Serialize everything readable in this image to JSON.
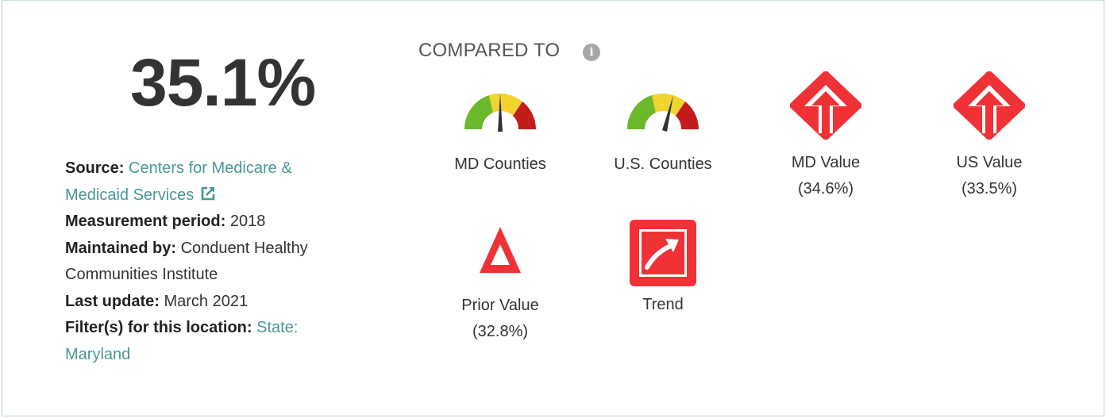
{
  "main_value": "35.1%",
  "source": {
    "source_label": "Source:",
    "source_link": "Centers for Medicare & Medicaid Services",
    "period_label": "Measurement period:",
    "period_value": "2018",
    "maintained_label": "Maintained by:",
    "maintained_value": "Conduent Healthy Communities Institute",
    "update_label": "Last update:",
    "update_value": "March 2021",
    "filter_label": "Filter(s) for this location:",
    "filter_link": "State: Maryland"
  },
  "compared": {
    "heading": "COMPARED TO",
    "info_glyph": "i",
    "items": [
      {
        "label": "MD Counties",
        "icon": "gauge-icon"
      },
      {
        "label": "U.S. Counties",
        "icon": "gauge-icon"
      },
      {
        "label": "MD Value",
        "value": "(34.6%)",
        "icon": "up-arrow-diamond-icon"
      },
      {
        "label": "US Value",
        "value": "(33.5%)",
        "icon": "up-arrow-diamond-icon"
      },
      {
        "label": "Prior Value",
        "value": "(32.8%)",
        "icon": "triangle-icon"
      },
      {
        "label": "Trend",
        "icon": "trend-up-icon"
      }
    ]
  },
  "colors": {
    "green": "#6bb82a",
    "yellow": "#f2d430",
    "red": "#c41b1b",
    "alert_red": "#f03236",
    "link": "#4a9797"
  }
}
